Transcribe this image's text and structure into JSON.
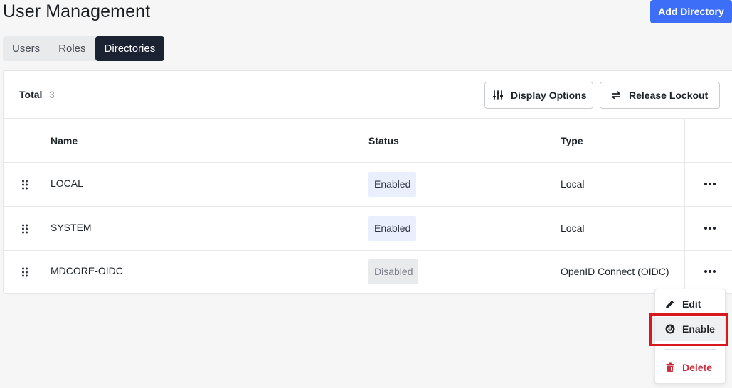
{
  "header": {
    "title": "User Management",
    "add_button": "Add Directory"
  },
  "tabs": [
    {
      "label": "Users",
      "active": false
    },
    {
      "label": "Roles",
      "active": false
    },
    {
      "label": "Directories",
      "active": true
    }
  ],
  "toolbar": {
    "total_label": "Total",
    "total_count": "3",
    "display_options": "Display Options",
    "release_lockout": "Release Lockout"
  },
  "table": {
    "columns": [
      "Name",
      "Status",
      "Type"
    ],
    "rows": [
      {
        "name": "LOCAL",
        "status": "Enabled",
        "type": "Local"
      },
      {
        "name": "SYSTEM",
        "status": "Enabled",
        "type": "Local"
      },
      {
        "name": "MDCORE-OIDC",
        "status": "Disabled",
        "type": "OpenID Connect (OIDC)"
      }
    ]
  },
  "context_menu": {
    "edit": "Edit",
    "enable": "Enable",
    "delete": "Delete"
  },
  "colors": {
    "primary": "#3d6ef7",
    "tab_active": "#1b2232",
    "danger": "#c8303f",
    "highlight": "#d7191f"
  },
  "icons": [
    "sliders-icon",
    "swap-icon",
    "drag-handle-icon",
    "more-horizontal-icon",
    "pencil-icon",
    "power-icon",
    "trash-icon"
  ]
}
